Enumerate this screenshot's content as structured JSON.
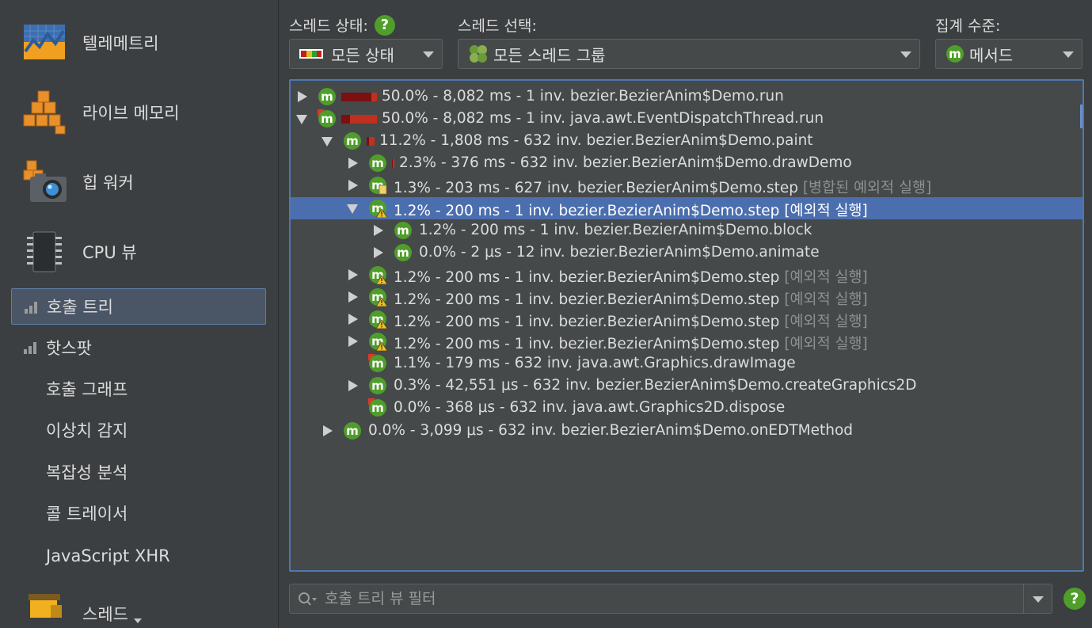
{
  "sidebar": {
    "telemetry": "텔레메트리",
    "live_memory": "라이브 메모리",
    "heap_walker": "힙 워커",
    "cpu_view": "CPU 뷰",
    "call_tree": "호출 트리",
    "hotspots": "핫스팟",
    "call_graph": "호출 그래프",
    "outlier": "이상치 감지",
    "complexity": "복잡성 분석",
    "call_tracer": "콜 트레이서",
    "js_xhr": "JavaScript XHR",
    "threads": "스레드"
  },
  "controls": {
    "thread_state_label": "스레드 상태:",
    "thread_state_value": "모든 상태",
    "thread_select_label": "스레드 선택:",
    "thread_select_value": "모든 스레드 그룹",
    "aggregation_label": "집계 수준:",
    "aggregation_value": "메서드",
    "help": "?"
  },
  "tree": [
    {
      "text": "50.0% - 8,082 ms - 1 inv. bezier.BezierAnim$Demo.run",
      "suffix": "",
      "toggle": "collapsed",
      "selected": false,
      "percent": 50.0
    },
    {
      "text": "50.0% - 8,082 ms - 1 inv. java.awt.EventDispatchThread.run",
      "suffix": "",
      "toggle": "expanded",
      "selected": false,
      "percent": 50.0
    },
    {
      "text": "11.2% - 1,808 ms - 632 inv. bezier.BezierAnim$Demo.paint",
      "suffix": "",
      "toggle": "expanded",
      "selected": false,
      "percent": 11.2
    },
    {
      "text": "2.3% - 376 ms - 632 inv. bezier.BezierAnim$Demo.drawDemo",
      "suffix": "",
      "toggle": "collapsed",
      "selected": false,
      "percent": 2.3
    },
    {
      "text": "1.3% - 203 ms - 627 inv. bezier.BezierAnim$Demo.step ",
      "suffix": "[병합된 예외적 실행]",
      "toggle": "collapsed",
      "selected": false,
      "percent": 1.3
    },
    {
      "text": "1.2% - 200 ms - 1 inv. bezier.BezierAnim$Demo.step ",
      "suffix": "[예외적 실행]",
      "toggle": "expanded",
      "selected": true,
      "percent": 1.2
    },
    {
      "text": "1.2% - 200 ms - 1 inv. bezier.BezierAnim$Demo.block",
      "suffix": "",
      "toggle": "collapsed",
      "selected": false,
      "percent": 1.2
    },
    {
      "text": "0.0% - 2 μs - 12 inv. bezier.BezierAnim$Demo.animate",
      "suffix": "",
      "toggle": "collapsed",
      "selected": false,
      "percent": 0.0
    },
    {
      "text": "1.2% - 200 ms - 1 inv. bezier.BezierAnim$Demo.step ",
      "suffix": "[예외적 실행]",
      "toggle": "collapsed",
      "selected": false,
      "percent": 1.2
    },
    {
      "text": "1.2% - 200 ms - 1 inv. bezier.BezierAnim$Demo.step ",
      "suffix": "[예외적 실행]",
      "toggle": "collapsed",
      "selected": false,
      "percent": 1.2
    },
    {
      "text": "1.2% - 200 ms - 1 inv. bezier.BezierAnim$Demo.step ",
      "suffix": "[예외적 실행]",
      "toggle": "collapsed",
      "selected": false,
      "percent": 1.2
    },
    {
      "text": "1.2% - 200 ms - 1 inv. bezier.BezierAnim$Demo.step ",
      "suffix": "[예외적 실행]",
      "toggle": "collapsed",
      "selected": false,
      "percent": 1.2
    },
    {
      "text": "1.1% - 179 ms - 632 inv. java.awt.Graphics.drawImage",
      "suffix": "",
      "toggle": "none",
      "selected": false,
      "percent": 1.1
    },
    {
      "text": "0.3% - 42,551 μs - 632 inv. bezier.BezierAnim$Demo.createGraphics2D",
      "suffix": "",
      "toggle": "collapsed",
      "selected": false,
      "percent": 0.3
    },
    {
      "text": "0.0% - 368 μs - 632 inv. java.awt.Graphics2D.dispose",
      "suffix": "",
      "toggle": "none",
      "selected": false,
      "percent": 0.0
    },
    {
      "text": "0.0% - 3,099 μs - 632 inv. bezier.BezierAnim$Demo.onEDTMethod",
      "suffix": "",
      "toggle": "collapsed",
      "selected": false,
      "percent": 0.0
    }
  ],
  "filter": {
    "placeholder": "호출 트리 뷰 필터",
    "help": "?"
  },
  "colors": {
    "accent": "#4b6eaf",
    "method_icon": "#4f9d2a",
    "bar_dark": "#7a1010",
    "bar_red": "#c0301e"
  }
}
